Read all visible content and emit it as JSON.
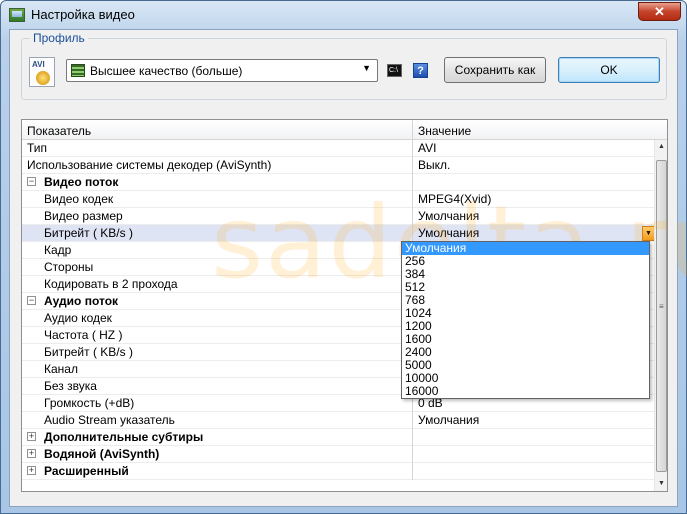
{
  "window": {
    "title": "Настройка видео",
    "close_symbol": "✕"
  },
  "profile": {
    "legend": "Профиль",
    "avi_icon_label": "AVI",
    "selected": "Высшее качество (больше)",
    "arrow": "▼",
    "cmd_icon_text": "C:\\",
    "help_icon_text": "?",
    "save_label": "Сохранить как",
    "ok_label": "OK"
  },
  "grid": {
    "header_name": "Показатель",
    "header_value": "Значение",
    "rows": [
      {
        "name": "Тип",
        "value": "AVI"
      },
      {
        "name": "Использование системы декодер (AviSynth)",
        "value": "Выкл."
      },
      {
        "name": "Видео поток",
        "value": "",
        "expander": "−"
      },
      {
        "name": "Видео кодек",
        "value": "MPEG4(Xvid)"
      },
      {
        "name": "Видео размер",
        "value": "Умолчания"
      },
      {
        "name": "Битрейт ( KB/s )",
        "value": "Умолчания",
        "dropdown": "▼"
      },
      {
        "name": "Кадр",
        "value": ""
      },
      {
        "name": "Стороны",
        "value": ""
      },
      {
        "name": "Кодировать в 2 прохода",
        "value": ""
      },
      {
        "name": "Аудио поток",
        "value": "",
        "expander": "−"
      },
      {
        "name": "Аудио кодек",
        "value": ""
      },
      {
        "name": "Частота ( HZ )",
        "value": ""
      },
      {
        "name": "Битрейт ( KB/s )",
        "value": ""
      },
      {
        "name": "Канал",
        "value": ""
      },
      {
        "name": "Без звука",
        "value": ""
      },
      {
        "name": "Громкость (+dB)",
        "value": "0 dB"
      },
      {
        "name": "Audio Stream указатель",
        "value": "Умолчания"
      },
      {
        "name": "Дополнительные субтиры",
        "value": "",
        "expander": "+"
      },
      {
        "name": "Водяной (AviSynth)",
        "value": "",
        "expander": "+"
      },
      {
        "name": "Расширенный",
        "value": "",
        "expander": "+"
      }
    ]
  },
  "dropdown": {
    "options": [
      "Умолчания",
      "256",
      "384",
      "512",
      "768",
      "1024",
      "1200",
      "1600",
      "2400",
      "5000",
      "10000",
      "16000"
    ],
    "selected_index": 0
  },
  "scrollbar": {
    "up": "▲",
    "down": "▼",
    "grip": "≡"
  },
  "watermark": "sadelta.ru"
}
